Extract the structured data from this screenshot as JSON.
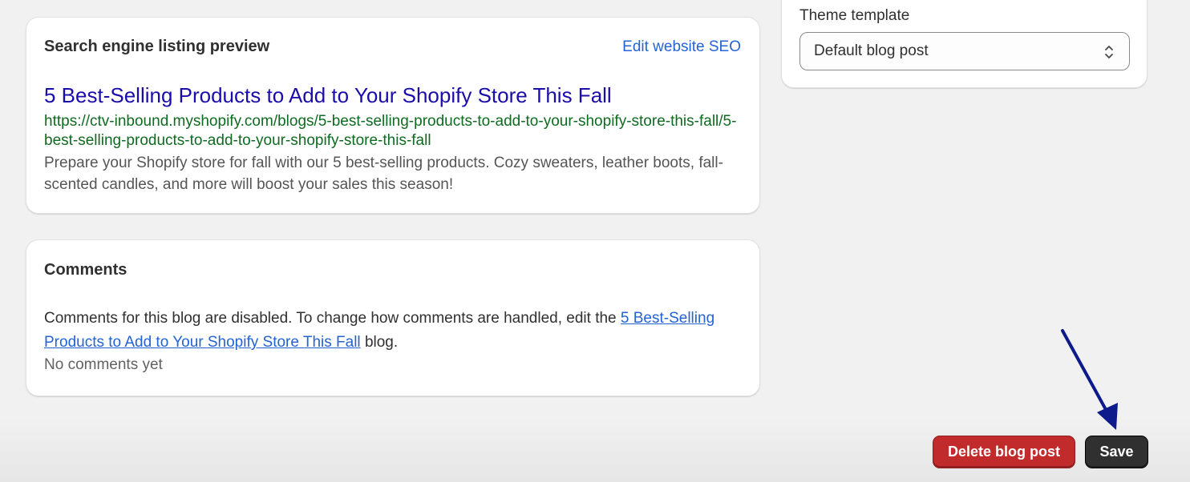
{
  "seo": {
    "heading": "Search engine listing preview",
    "edit_link": "Edit website SEO",
    "title": "5 Best-Selling Products to Add to Your Shopify Store This Fall",
    "url": "https://ctv-inbound.myshopify.com/blogs/5-best-selling-products-to-add-to-your-shopify-store-this-fall/5-best-selling-products-to-add-to-your-shopify-store-this-fall",
    "description": "Prepare your Shopify store for fall with our 5 best-selling products. Cozy sweaters, leather boots, fall-scented candles, and more will boost your sales this season!"
  },
  "comments": {
    "heading": "Comments",
    "text_before": "Comments for this blog are disabled. To change how comments are handled, edit the ",
    "blog_link": "5 Best-Selling Products to Add to Your Shopify Store This Fall",
    "text_after": " blog.",
    "empty_state": "No comments yet"
  },
  "theme": {
    "label": "Theme template",
    "selected": "Default blog post",
    "icon": "select-arrows-icon"
  },
  "actions": {
    "delete_label": "Delete blog post",
    "save_label": "Save"
  },
  "annotation": {
    "icon": "arrow-pointer-icon",
    "color": "#0c1a8c"
  },
  "colors": {
    "link": "#2463d3",
    "seo_title": "#1a0dab",
    "seo_url": "#0e6b1f",
    "delete": "#c22b2b",
    "save": "#303030"
  }
}
